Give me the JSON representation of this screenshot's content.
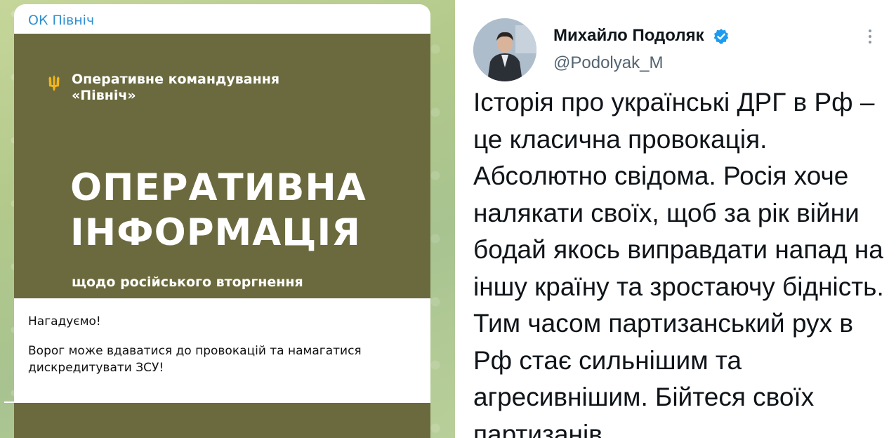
{
  "telegram": {
    "channel_name": "ОК Північ",
    "card": {
      "org_name": "Оперативне командування «Північ»",
      "headline_line1": "ОПЕРАТИВНА",
      "headline_line2": "ІНФОРМАЦІЯ",
      "subtitle": "щодо російського вторгнення",
      "background_color": "#6b6a3e",
      "emblem_color": "#f2b51b"
    },
    "message_paragraph_1": "Нагадуємо!",
    "message_paragraph_2": "Ворог може вдаватися до провокацій та намагатися дискредитувати ЗСУ!",
    "link_color": "#2f8fd1"
  },
  "tweet": {
    "author_name": "Михайло Подоляк",
    "handle": "@Podolyak_M",
    "verified_badge_color": "#1d9bf0",
    "text": "Історія про українські ДРГ в Рф – це класична провокація. Абсолютно свідома. Росія хоче налякати своїх, щоб за рік війни бодай якось виправдати напад на іншу країну та зростаючу бідність. Тим часом партизанський рух в Рф стає сильнішим та агресивнішим. Бійтеся своїх партизанів…"
  }
}
